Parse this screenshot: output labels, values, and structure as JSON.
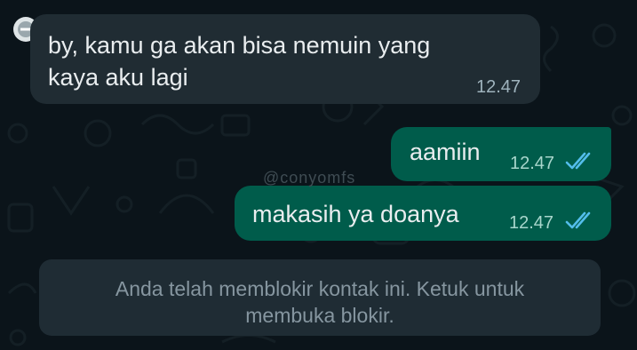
{
  "messages": [
    {
      "direction": "incoming",
      "text": "by, kamu ga akan bisa nemuin yang\nkaya aku lagi",
      "time": "12.47"
    },
    {
      "direction": "outgoing",
      "text": "aamiin",
      "time": "12.47",
      "status": "read"
    },
    {
      "direction": "outgoing",
      "text": "makasih ya doanya",
      "time": "12.47",
      "status": "read"
    }
  ],
  "watermark": "@conyomfs",
  "system_notice": {
    "text": "Anda telah memblokir kontak ini. Ketuk untuk\nmembuka blokir."
  },
  "colors": {
    "background": "#0b141a",
    "incoming_bubble": "#202c33",
    "outgoing_bubble": "#005c4b",
    "read_ticks": "#53bdeb"
  },
  "icons": {
    "avatar": "blocked-avatar-icon",
    "status": "double-check-icon"
  }
}
